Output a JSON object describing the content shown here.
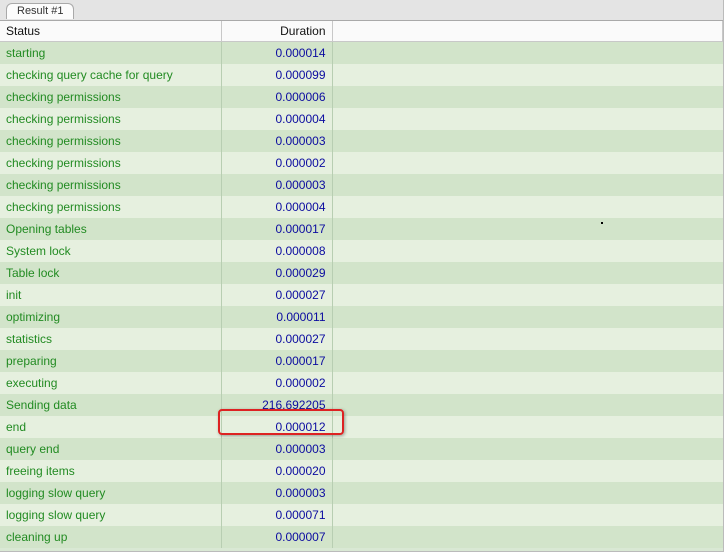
{
  "tab": {
    "label": "Result #1"
  },
  "columns": {
    "status": "Status",
    "duration": "Duration"
  },
  "rows": [
    {
      "status": "starting",
      "duration": "0.000014"
    },
    {
      "status": "checking query cache for query",
      "duration": "0.000099"
    },
    {
      "status": "checking permissions",
      "duration": "0.000006"
    },
    {
      "status": "checking permissions",
      "duration": "0.000004"
    },
    {
      "status": "checking permissions",
      "duration": "0.000003"
    },
    {
      "status": "checking permissions",
      "duration": "0.000002"
    },
    {
      "status": "checking permissions",
      "duration": "0.000003"
    },
    {
      "status": "checking permissions",
      "duration": "0.000004"
    },
    {
      "status": "Opening tables",
      "duration": "0.000017"
    },
    {
      "status": "System lock",
      "duration": "0.000008"
    },
    {
      "status": "Table lock",
      "duration": "0.000029"
    },
    {
      "status": "init",
      "duration": "0.000027"
    },
    {
      "status": "optimizing",
      "duration": "0.000011"
    },
    {
      "status": "statistics",
      "duration": "0.000027"
    },
    {
      "status": "preparing",
      "duration": "0.000017"
    },
    {
      "status": "executing",
      "duration": "0.000002"
    },
    {
      "status": "Sending data",
      "duration": "216.692205"
    },
    {
      "status": "end",
      "duration": "0.000012"
    },
    {
      "status": "query end",
      "duration": "0.000003"
    },
    {
      "status": "freeing items",
      "duration": "0.000020"
    },
    {
      "status": "logging slow query",
      "duration": "0.000003"
    },
    {
      "status": "logging slow query",
      "duration": "0.000071"
    },
    {
      "status": "cleaning up",
      "duration": "0.000007"
    }
  ],
  "highlight_row_index": 16
}
